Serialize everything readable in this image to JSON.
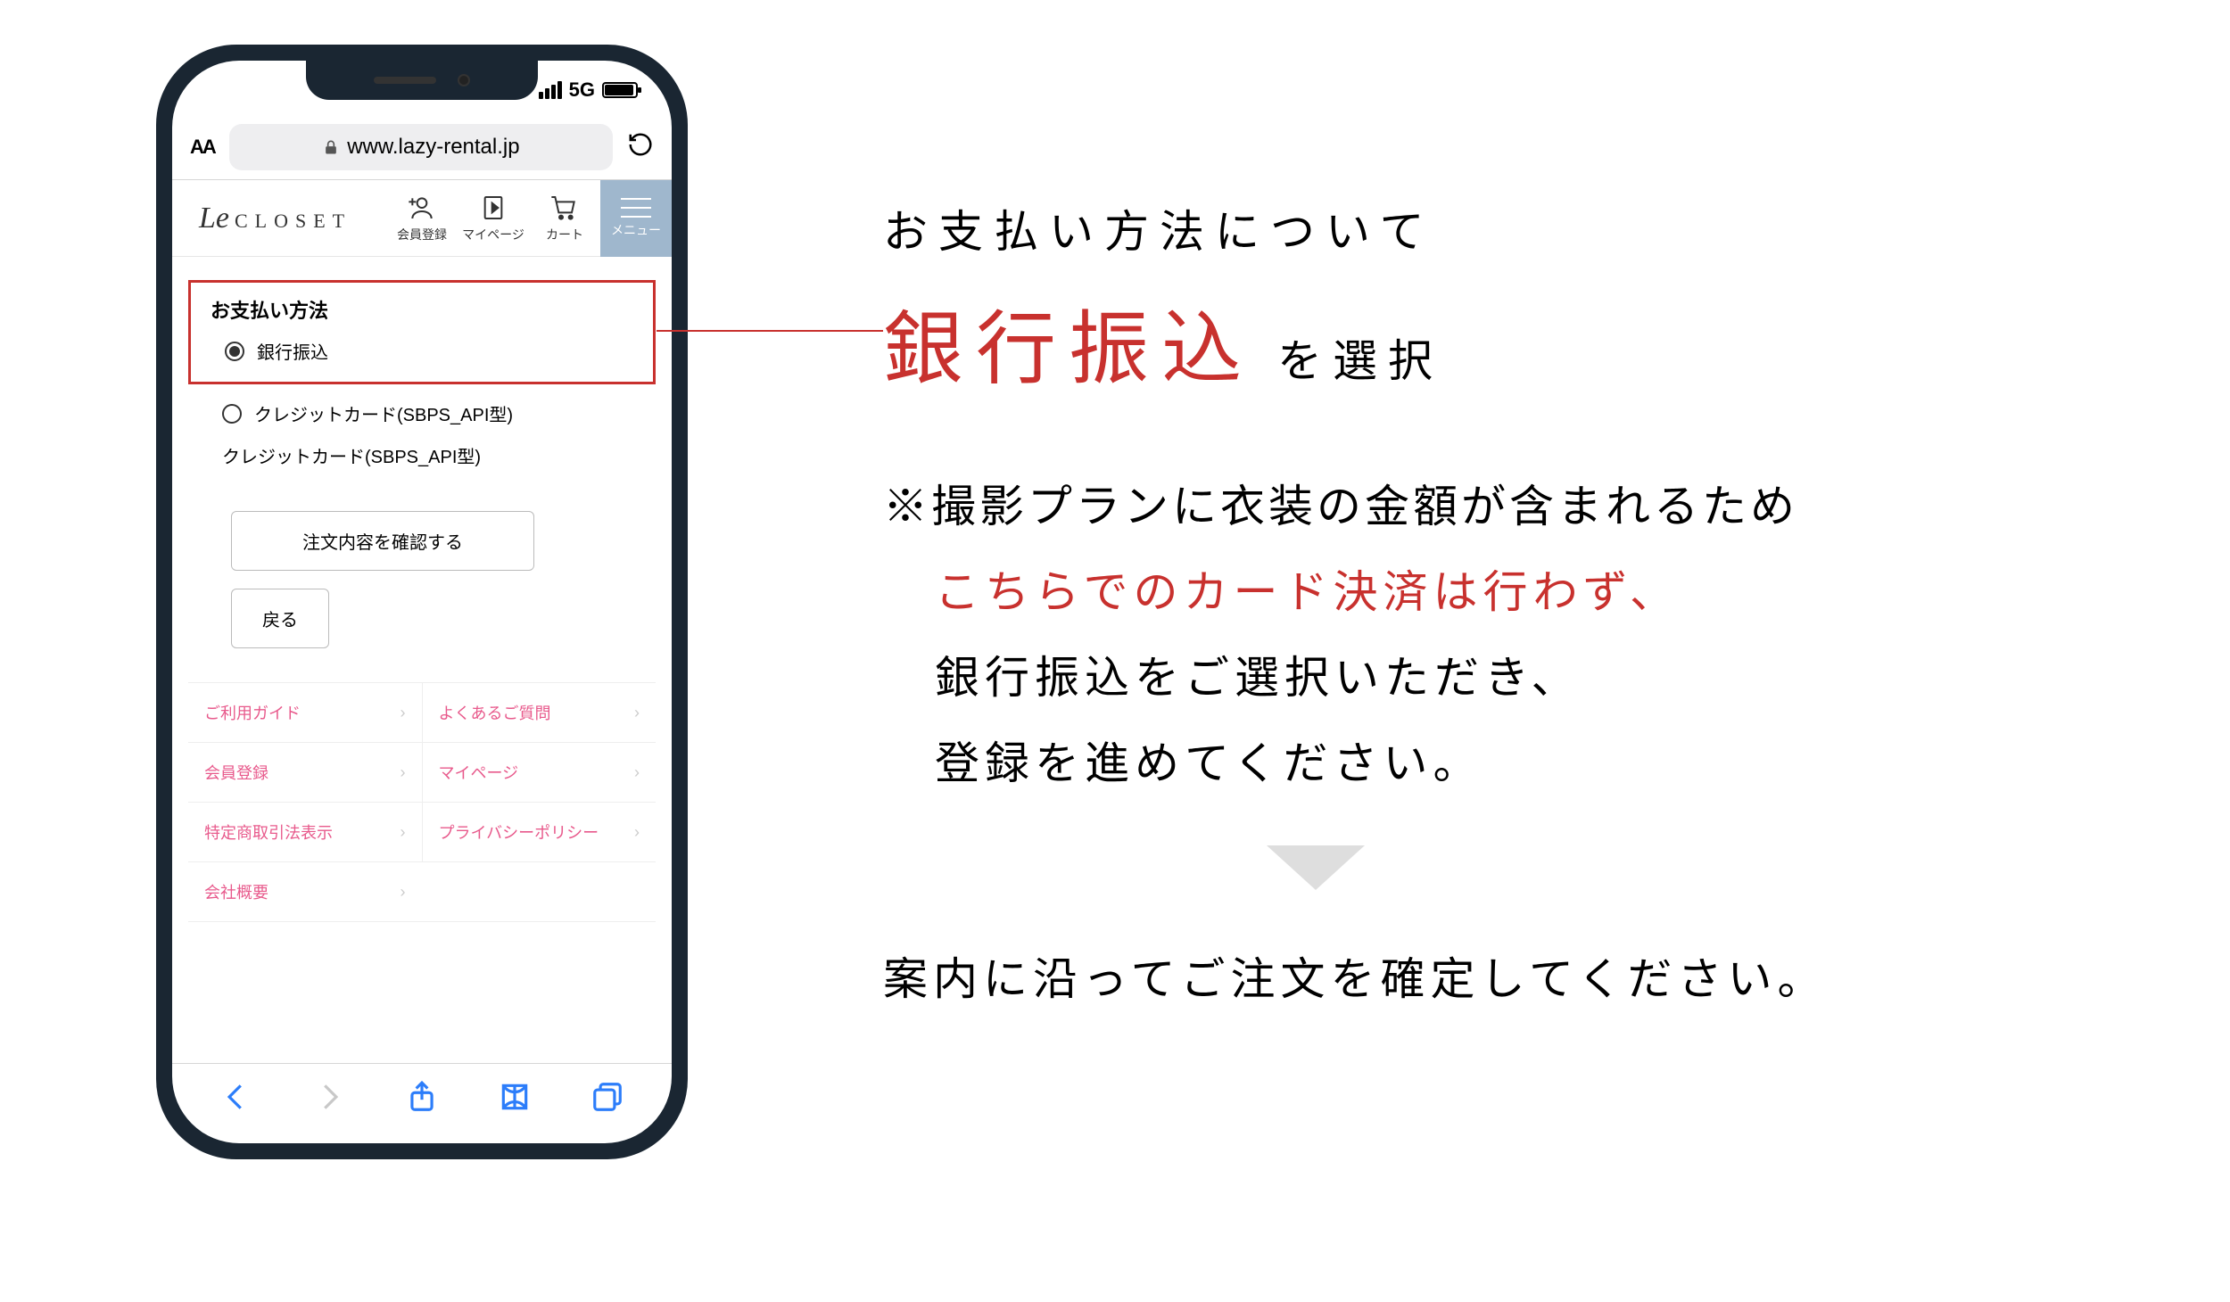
{
  "statusbar": {
    "network": "5G"
  },
  "browser": {
    "textsize_label": "AA",
    "url_display": "www.lazy-rental.jp"
  },
  "site_header": {
    "logo_script": "Le",
    "logo_text": "CLOSET",
    "register_label": "会員登録",
    "mypage_label": "マイページ",
    "cart_label": "カート",
    "menu_label": "メニュー"
  },
  "payment": {
    "heading": "お支払い方法",
    "option_bank": "銀行振込",
    "option_card": "クレジットカード(SBPS_API型)",
    "saved_method": "クレジットカード(SBPS_API型)",
    "confirm_button": "注文内容を確認する",
    "back_button": "戻る"
  },
  "footer_links": {
    "guide": "ご利用ガイド",
    "faq": "よくあるご質問",
    "register": "会員登録",
    "mypage": "マイページ",
    "legal": "特定商取引法表示",
    "privacy": "プライバシーポリシー",
    "company": "会社概要"
  },
  "instruction": {
    "line1": "お支払い方法について",
    "highlight": "銀行振込",
    "suffix": "を選択",
    "note_a": "※撮影プランに衣装の金額が含まれるため",
    "note_b": "こちらでのカード決済は行わず、",
    "note_c": "銀行振込をご選択いただき、",
    "note_d": "登録を進めてください。",
    "final": "案内に沿ってご注文を確定してください。"
  }
}
